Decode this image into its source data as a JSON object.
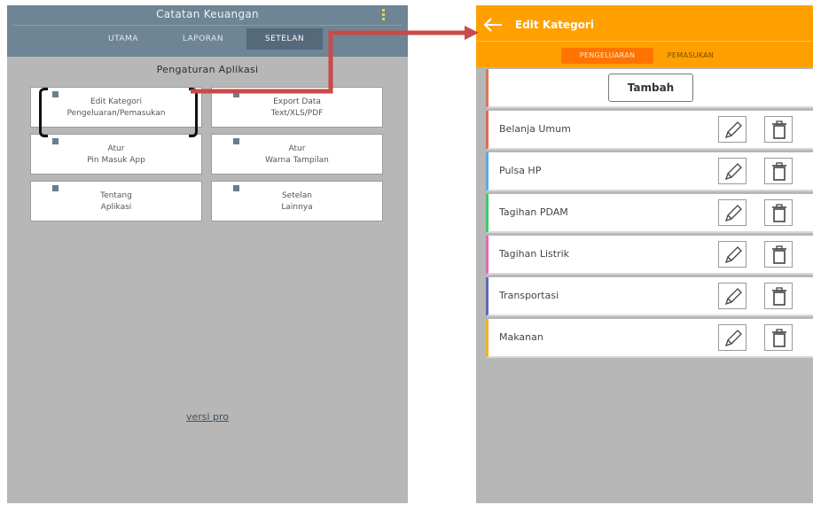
{
  "left": {
    "app_title": "Catatan Keuangan",
    "tabs": [
      {
        "label": "UTAMA",
        "active": false
      },
      {
        "label": "LAPORAN",
        "active": false
      },
      {
        "label": "SETELAN",
        "active": true
      }
    ],
    "section_title": "Pengaturan Aplikasi",
    "cards": [
      {
        "line1": "Edit Kategori",
        "line2": "Pengeluaran/Pemasukan"
      },
      {
        "line1": "Export Data",
        "line2": "Text/XLS/PDF"
      },
      {
        "line1": "Atur",
        "line2": "Pin Masuk App"
      },
      {
        "line1": "Atur",
        "line2": "Warna Tampilan"
      },
      {
        "line1": "Tentang",
        "line2": "Aplikasi"
      },
      {
        "line1": "Setelan",
        "line2": "Lainnya"
      }
    ],
    "footer_link": "versi pro"
  },
  "right": {
    "title": "Edit Kategori",
    "segments": [
      {
        "label": "PENGELUARAN",
        "active": true
      },
      {
        "label": "PEMASUKAN",
        "active": false
      }
    ],
    "add_button": "Tambah",
    "categories": [
      {
        "name": "Belanja Umum",
        "color": "#e06a5a"
      },
      {
        "name": "Pulsa HP",
        "color": "#5aa9e0"
      },
      {
        "name": "Tagihan PDAM",
        "color": "#3fc76a"
      },
      {
        "name": "Tagihan Listrik",
        "color": "#e06ab0"
      },
      {
        "name": "Transportasi",
        "color": "#5a6ab8"
      },
      {
        "name": "Makanan",
        "color": "#f0b030"
      }
    ]
  },
  "colors": {
    "left_appbar": "#6d8594",
    "right_appbar": "#ffa000",
    "active_segment": "#ff7400",
    "connector": "#c94a4a"
  }
}
